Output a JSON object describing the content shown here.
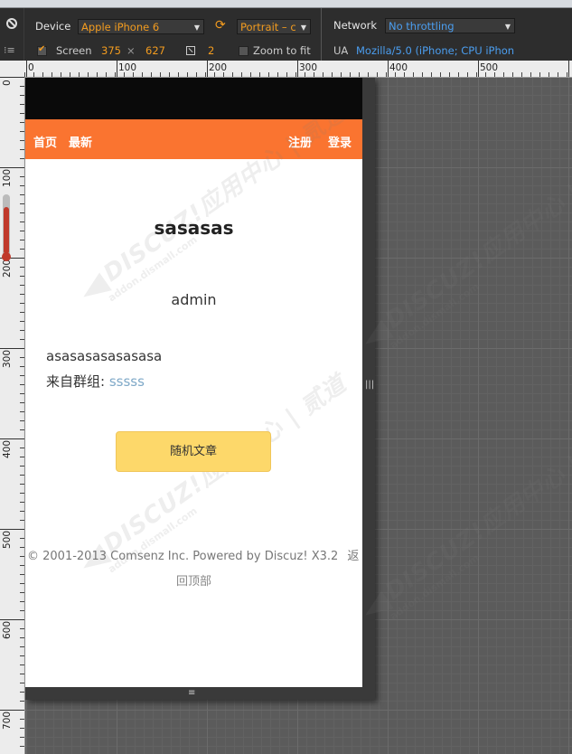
{
  "devtools": {
    "device_label": "Device",
    "device_value": "Apple iPhone 6",
    "orientation_value": "Portrait – c",
    "screen_label": "Screen",
    "screen_width": "375",
    "screen_times": "×",
    "screen_height": "627",
    "dpr_value": "2",
    "zoom_label": "Zoom to fit",
    "network_label": "Network",
    "network_value": "No throttling",
    "ua_label": "UA",
    "ua_value": "Mozilla/5.0 (iPhone; CPU iPhon..."
  },
  "ruler": {
    "h_ticks": [
      "0",
      "100",
      "200",
      "300",
      "400",
      "500"
    ],
    "v_ticks": [
      "0",
      "100",
      "200",
      "300",
      "400",
      "500",
      "600",
      "700"
    ]
  },
  "page": {
    "nav_home": "首页",
    "nav_latest": "最新",
    "nav_register": "注册",
    "nav_login": "登录",
    "title": "sasasas",
    "author": "admin",
    "content": "asasasasasasasa",
    "group_prefix": "来自群组: ",
    "group_link": "sssss",
    "random_button": "随机文章",
    "footer": "© 2001-2013 Comsenz Inc. Powered by Discuz! X3.2",
    "footer_back": "返",
    "back_to_top": "回顶部",
    "watermark_brand": "DISCUZ!应用中心 | 贰道",
    "watermark_url": "addon.dismall.com"
  }
}
